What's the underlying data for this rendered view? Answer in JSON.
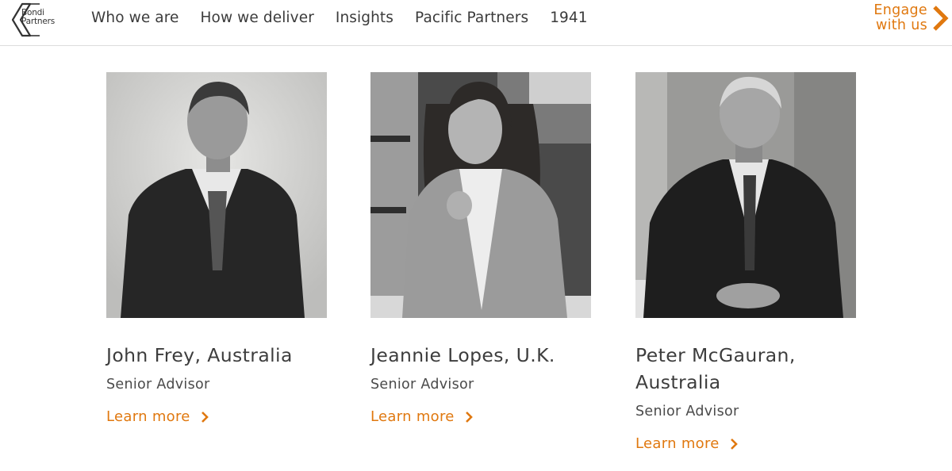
{
  "brand": {
    "logo_line1": "Bondi",
    "logo_line2": "Partners",
    "accent_color": "#e0780f"
  },
  "nav": {
    "items": [
      "Who we are",
      "How we deliver",
      "Insights",
      "Pacific Partners",
      "1941"
    ]
  },
  "cta": {
    "line1": "Engage",
    "line2": "with us",
    "icon": "chevron-right-icon"
  },
  "people": [
    {
      "name": "John Frey, Australia",
      "role": "Senior Advisor",
      "link": "Learn more"
    },
    {
      "name": "Jeannie Lopes, U.K.",
      "role": "Senior Advisor",
      "link": "Learn more"
    },
    {
      "name": "Peter McGauran, Australia",
      "role": "Senior Advisor",
      "link": "Learn more"
    }
  ]
}
